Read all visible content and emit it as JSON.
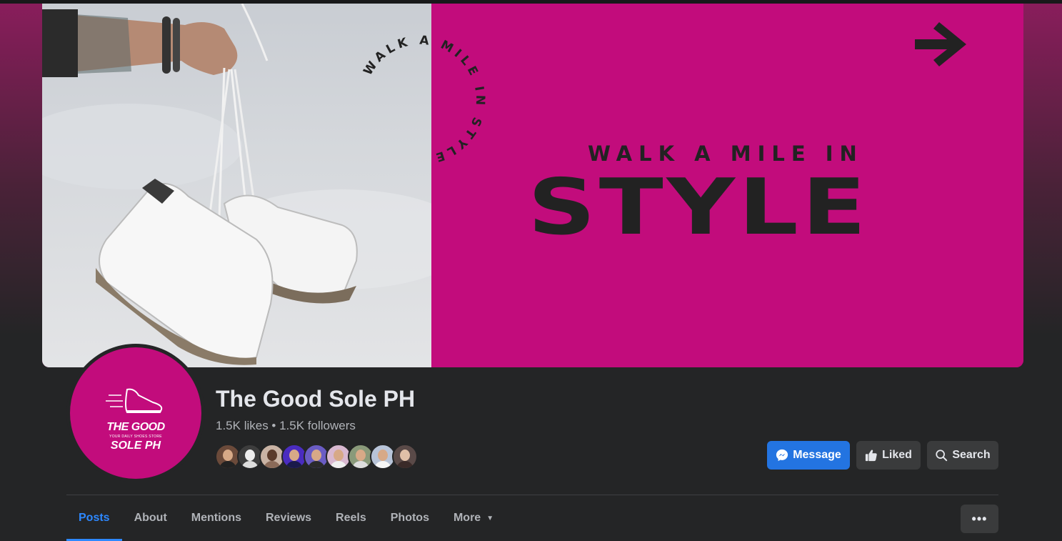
{
  "cover": {
    "ring_text": "WALK A MILE IN STYLE",
    "tagline": "WALK A MILE IN",
    "headline": "STYLE"
  },
  "avatar": {
    "brand_line1": "THE GOOD",
    "brand_tagline": "YOUR DAILY SHOES STORE",
    "brand_line2": "SOLE PH"
  },
  "profile": {
    "name": "The Good Sole PH",
    "stats": "1.5K likes • 1.5K followers"
  },
  "actions": {
    "message": "Message",
    "liked": "Liked",
    "search": "Search",
    "more": "•••"
  },
  "tabs": [
    {
      "label": "Posts",
      "active": true
    },
    {
      "label": "About"
    },
    {
      "label": "Mentions"
    },
    {
      "label": "Reviews"
    },
    {
      "label": "Reels"
    },
    {
      "label": "Photos"
    },
    {
      "label": "More"
    }
  ],
  "colors": {
    "brand_pink": "#c20c7c",
    "accent_blue": "#2374e1",
    "active_tab": "#2d88ff"
  }
}
